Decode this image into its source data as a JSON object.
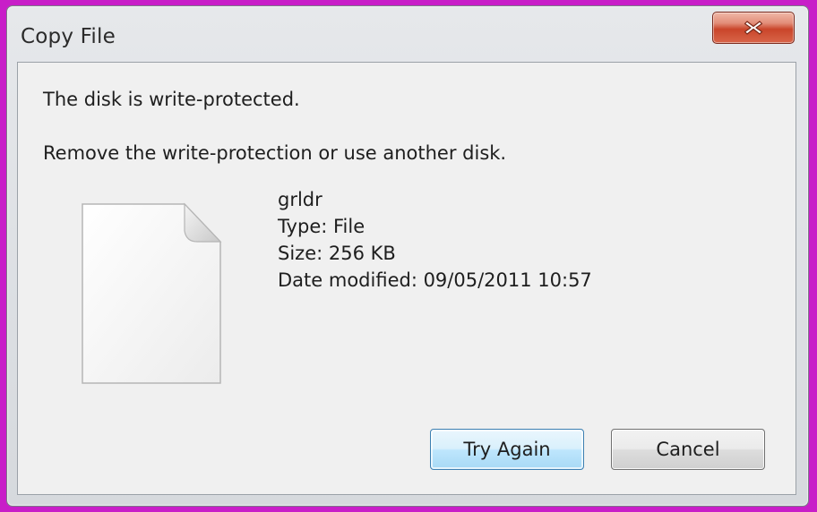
{
  "dialog": {
    "title": "Copy File",
    "close_icon": "close-icon",
    "message_primary": "The disk is write-protected.",
    "message_secondary": "Remove the write-protection or use another disk.",
    "file": {
      "icon": "file-icon",
      "name": "grldr",
      "type": "Type: File",
      "size": "Size: 256 KB",
      "date_modified": "Date modified: 09/05/2011 10:57"
    },
    "buttons": {
      "try_again": "Try Again",
      "cancel": "Cancel"
    }
  },
  "colors": {
    "frame_border": "#c81ec8",
    "close_button": "#c9452a",
    "primary_button_border": "#3c7fb1"
  }
}
